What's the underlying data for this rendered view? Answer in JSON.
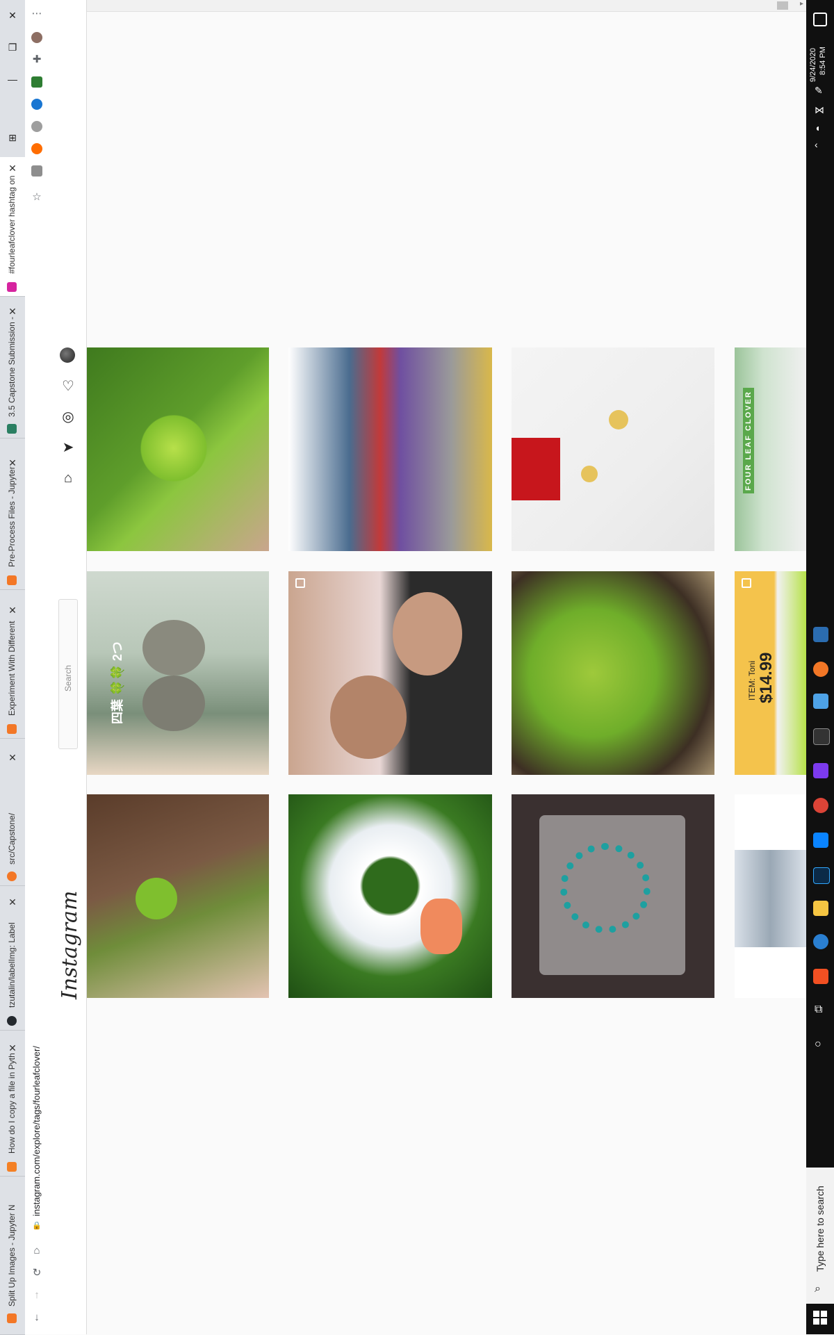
{
  "tabs": [
    {
      "title": "Split Up Images - Jupyter N",
      "favicon_color": "#f37726"
    },
    {
      "title": "How do I copy a file in Pyth",
      "favicon_color": "#f48024"
    },
    {
      "title": "tzutalin/labelImg: Label",
      "favicon_color": "#24292e"
    },
    {
      "title": "src/Capstone/",
      "favicon_color": "#f37726"
    },
    {
      "title": "Experiment With Different",
      "favicon_color": "#f37726"
    },
    {
      "title": "Pre-Process Files - Jupyter",
      "favicon_color": "#f37726"
    },
    {
      "title": "3.5 Capstone Submission -",
      "favicon_color": "#2a7f62"
    },
    {
      "title": "#fourleafclover hashtag on",
      "favicon_color": "#d6249f"
    }
  ],
  "address_bar": {
    "url": "instagram.com/explore/tags/fourleafclover/"
  },
  "instagram": {
    "logo": "Instagram",
    "search_placeholder": "Search"
  },
  "posts": [
    {
      "desc": "hand holding four leaf clover in grass",
      "colors": [
        "#3f7a1e",
        "#8cc63f",
        "#c9a58d"
      ]
    },
    {
      "desc": "street with colorful shops",
      "colors": [
        "#4a6c8f",
        "#c23a3a",
        "#9a9a9a"
      ]
    },
    {
      "desc": "gold clover necklace gift box",
      "colors": [
        "#f4f4f4",
        "#e6e6e6",
        "#c7161c"
      ]
    },
    {
      "desc": "four leaf clover article",
      "colors": [
        "#9bc49a",
        "#f0f0f0",
        "#5aa84b"
      ],
      "text_clip": "FOUR LEAF CLOVER"
    },
    {
      "desc": "owl photo with clover text",
      "colors": [
        "#b8c7b8",
        "#7a8f7a",
        "#e8d7c4"
      ],
      "text_clip": "四葉 🍀🍀 2つ"
    },
    {
      "desc": "two young men selfie",
      "colors": [
        "#2b2b2b",
        "#e9d7d5",
        "#caa58f"
      ]
    },
    {
      "desc": "clover plants growing",
      "colors": [
        "#6fae2a",
        "#3d2f24",
        "#9ec93b"
      ]
    },
    {
      "desc": "clover product ad",
      "colors": [
        "#f4c34c",
        "#f1f1f1",
        "#b7e24a"
      ],
      "item": "ITEM: Toni",
      "price": "$14.99"
    },
    {
      "desc": "clover ring on finger",
      "colors": [
        "#5a3c2a",
        "#6f8d3a",
        "#e3c3b2"
      ]
    },
    {
      "desc": "clover among daisies",
      "colors": [
        "#ffffff",
        "#2f6b1c",
        "#f2c21f"
      ]
    },
    {
      "desc": "bead bracelets with clover charms",
      "colors": [
        "#3a3030",
        "#1ea0a0",
        "#d8d8d8"
      ]
    },
    {
      "desc": "figurines display",
      "colors": [
        "#d9e0e8",
        "#9aa8b5",
        "#ffffff"
      ]
    }
  ],
  "taskbar": {
    "time": "8:54 PM",
    "date": "9/24/2020",
    "search_placeholder": "Type here to search"
  }
}
